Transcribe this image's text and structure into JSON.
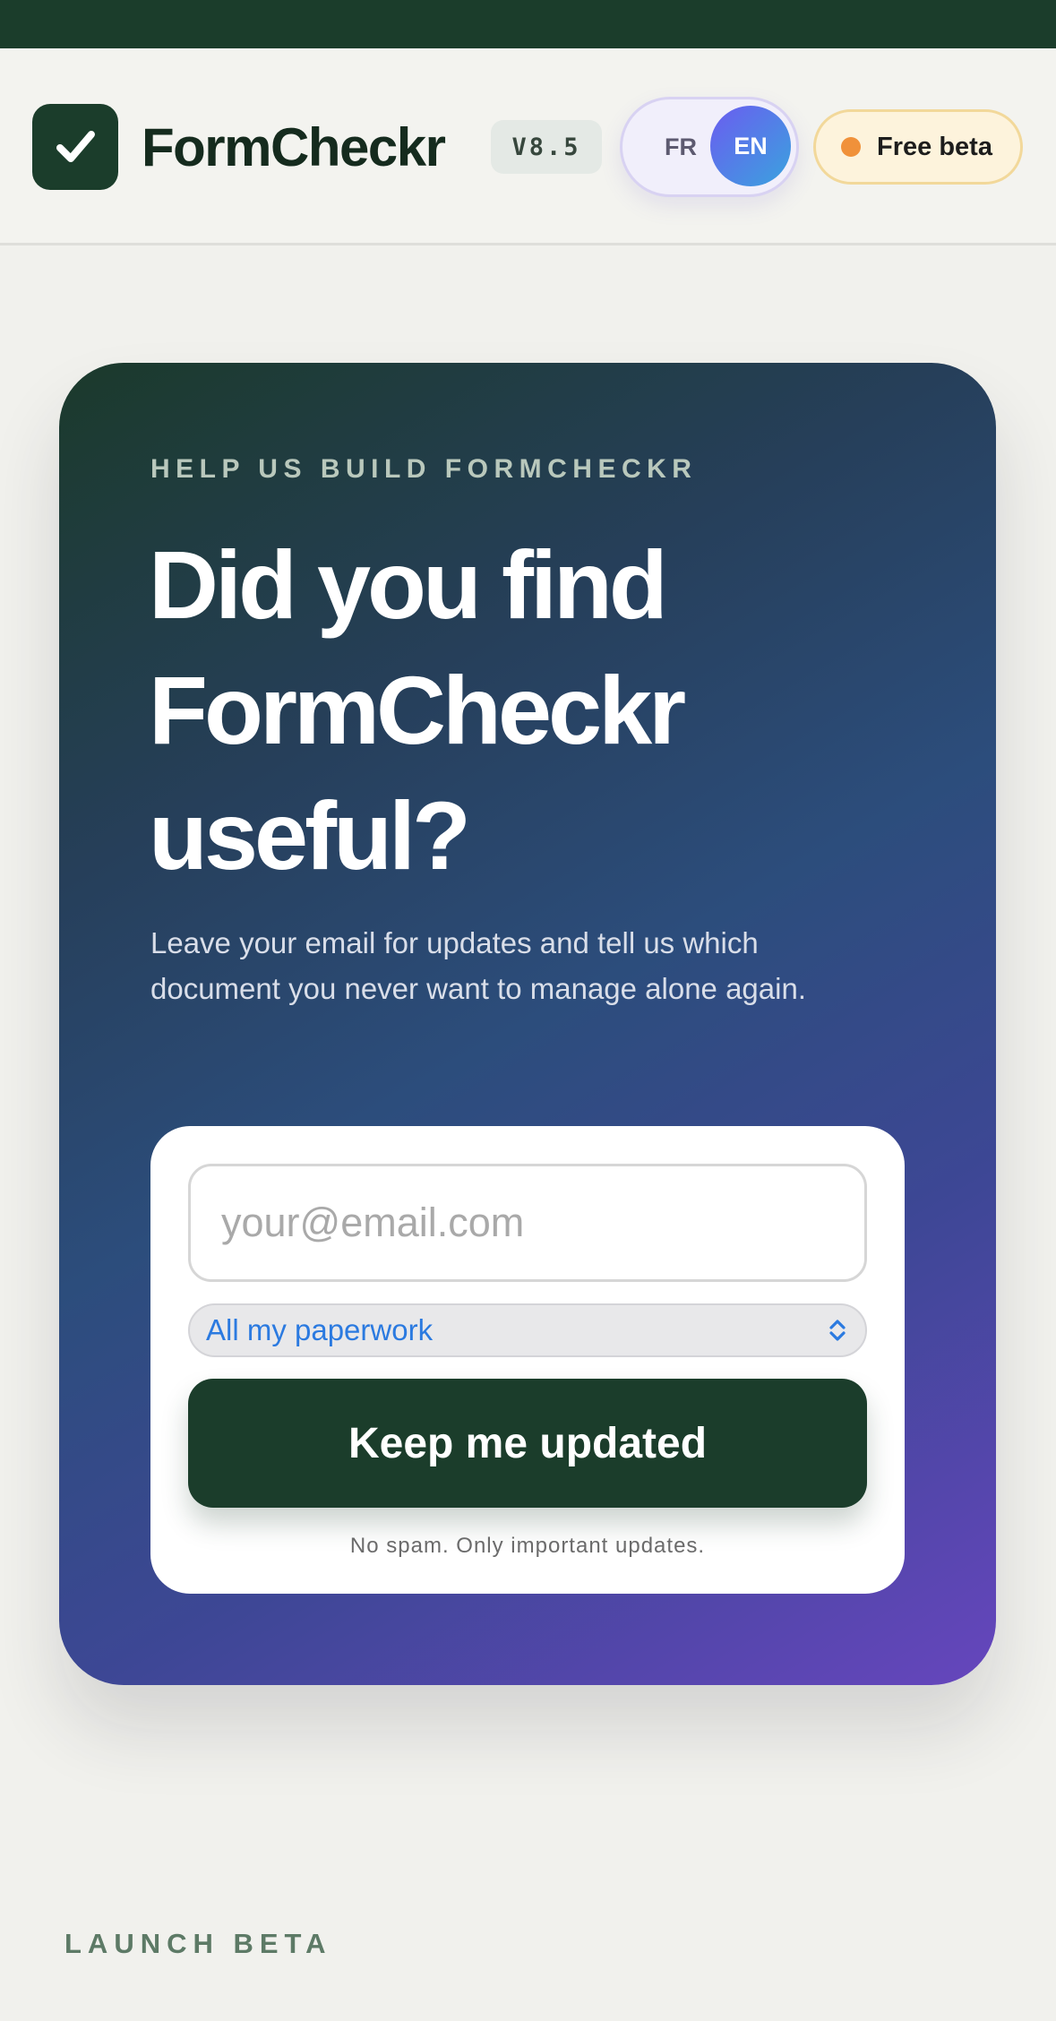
{
  "header": {
    "brand": "FormCheckr",
    "logo_icon": "checkmark-icon",
    "version": "V8.5",
    "languages": {
      "inactive": "FR",
      "active": "EN"
    },
    "beta_badge": "Free beta"
  },
  "signup": {
    "eyebrow": "HELP US BUILD FORMCHECKR",
    "headline": "Did you find FormCheckr useful?",
    "lead": "Leave your email for updates and tell us which document you never want to manage alone again.",
    "email_placeholder": "your@email.com",
    "document_select": {
      "value": "All my paperwork",
      "icon": "chevron-updown-icon"
    },
    "submit_label": "Keep me updated",
    "disclaimer": "No spam. Only important updates."
  },
  "footer": {
    "label": "LAUNCH BETA"
  },
  "colors": {
    "brand_green": "#1b3d2b",
    "gradient_end": "#6646bd",
    "select_text": "#2b7ae0",
    "beta_dot": "#f0913a"
  }
}
